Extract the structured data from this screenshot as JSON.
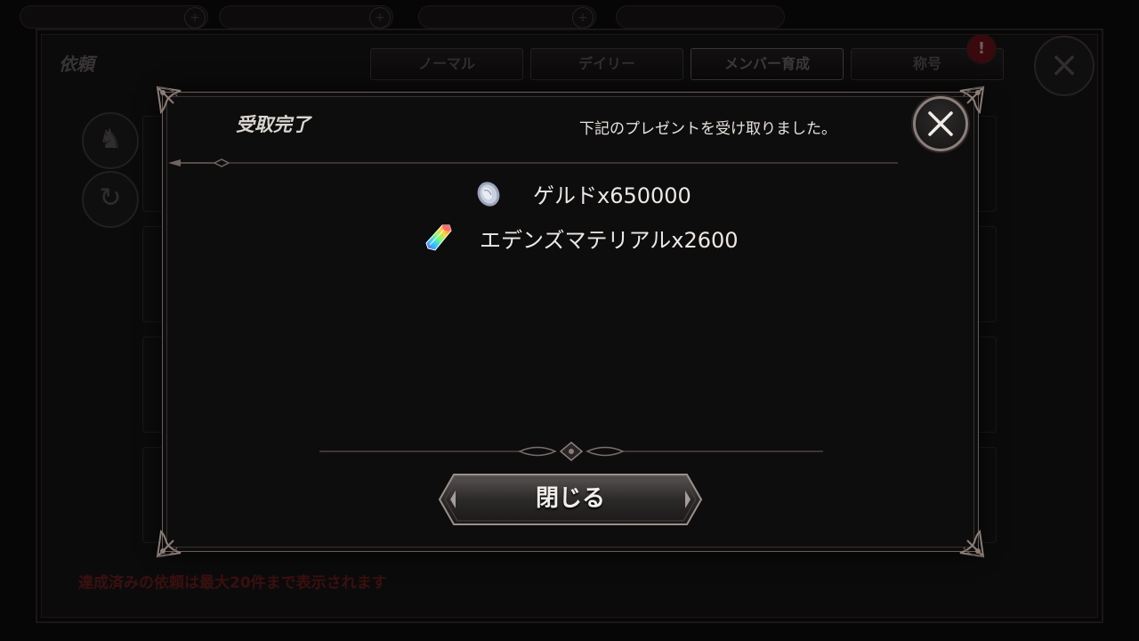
{
  "background": {
    "window_title": "依頼",
    "tabs": [
      {
        "label": "ノーマル",
        "active": false
      },
      {
        "label": "デイリー",
        "active": false
      },
      {
        "label": "メンバー育成",
        "active": true
      },
      {
        "label": "称号",
        "active": false
      }
    ],
    "alert_badge": "!",
    "footer_note": "達成済みの依頼は最大20件まで表示されます"
  },
  "modal": {
    "title": "受取完了",
    "subtitle": "下記のプレゼントを受け取りました。",
    "rewards": [
      {
        "icon": "silver-coin-icon",
        "label": "ゲルドx650000"
      },
      {
        "icon": "rainbow-crystal-icon",
        "label": "エデンズマテリアルx2600"
      }
    ],
    "close_button_label": "閉じる"
  },
  "colors": {
    "frame": "#6b5d58",
    "panel": "#0e0d0d",
    "text": "#ece8e3",
    "alert": "#5a0f14",
    "note_red": "#5a1a1a"
  }
}
